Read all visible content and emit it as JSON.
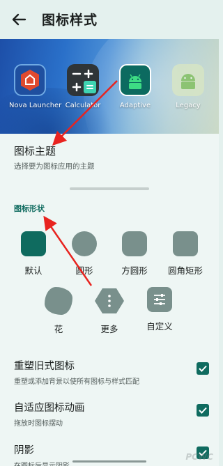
{
  "header": {
    "title": "图标样式"
  },
  "apps": [
    {
      "label": "Nova Launcher"
    },
    {
      "label": "Calculator"
    },
    {
      "label": "Adaptive"
    },
    {
      "label": "Legacy"
    }
  ],
  "theme": {
    "title": "图标主题",
    "subtitle": "选择要为图标应用的主题"
  },
  "shapes": {
    "section_title": "图标形状",
    "items": [
      {
        "label": "默认",
        "selected": true
      },
      {
        "label": "圆形"
      },
      {
        "label": "方圆形"
      },
      {
        "label": "圆角矩形"
      },
      {
        "label": "花"
      },
      {
        "label": "更多"
      },
      {
        "label": "自定义"
      }
    ]
  },
  "prefs": [
    {
      "title": "重塑旧式图标",
      "subtitle": "重塑或添加背景以使所有图标与样式匹配",
      "checked": true
    },
    {
      "title": "自适应图标动画",
      "subtitle": "拖放时图标摆动",
      "checked": true
    },
    {
      "title": "阴影",
      "subtitle": "在图标后显示阴影",
      "checked": true
    }
  ],
  "colors": {
    "accent": "#0f6b5f",
    "background": "#eef6f4",
    "annotation_arrow": "#e8231f"
  }
}
